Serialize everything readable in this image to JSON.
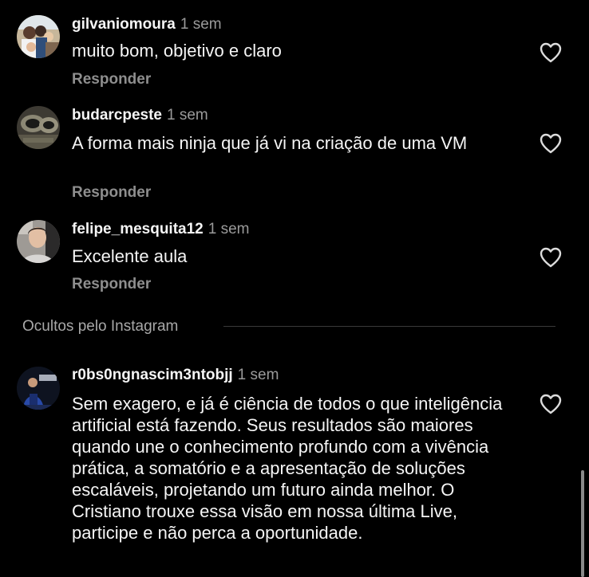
{
  "comments": [
    {
      "username": "gilvaniomoura",
      "time": "1 sem",
      "text": "muito bom, objetivo e claro",
      "reply_label": "Responder",
      "avatar_icon": "family-photo-avatar"
    },
    {
      "username": "budarcpeste",
      "time": "1 sem",
      "text": "A forma mais ninja que já vi na criação de uma VM",
      "reply_label": "Responder",
      "avatar_icon": "exhaust-pipes-avatar"
    },
    {
      "username": "felipe_mesquita12",
      "time": "1 sem",
      "text": "Excelente aula",
      "reply_label": "Responder",
      "avatar_icon": "person-photo-avatar"
    },
    {
      "username": "r0bs0ngnascim3ntobjj",
      "time": "1 sem",
      "text": "Sem exagero, e já é ciência de todos o que inteligência artificial está fazendo. Seus resultados são maiores quando une o conhecimento profundo com a vivência prática, a somatório e a apresentação de soluções escaláveis, projetando um futuro ainda melhor. O Cristiano trouxe essa visão em nossa última Live, participe e não perca a oportunidade.",
      "avatar_icon": "athlete-photo-avatar"
    }
  ],
  "hidden_section": {
    "label": "Ocultos pelo Instagram"
  },
  "colors": {
    "background": "#000000",
    "text": "#f5f5f5",
    "muted": "#8e8e8e",
    "divider": "#3a3a3a"
  }
}
